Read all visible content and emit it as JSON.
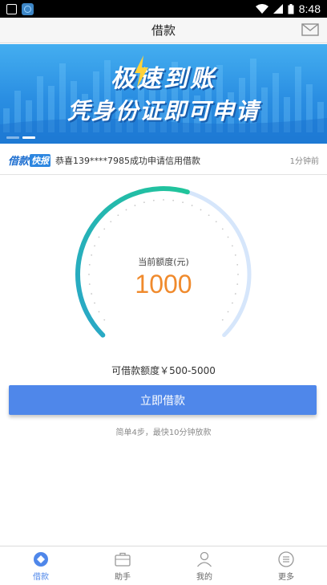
{
  "status_bar": {
    "time": "8:48"
  },
  "header": {
    "title": "借款"
  },
  "banner": {
    "line1": "极速到账",
    "line2": "凭身份证即可申请",
    "slide_count": 2,
    "active_slide": 1
  },
  "ticker": {
    "logo_part1": "借款",
    "logo_part2": "快报",
    "message": "恭喜139****7985成功申请信用借款",
    "time": "1分钟前"
  },
  "gauge": {
    "label": "当前额度(元)",
    "value": "1000",
    "amount": 1000,
    "min": 500,
    "max": 5000
  },
  "range_text": "可借款额度￥500-5000",
  "borrow_button": "立即借款",
  "hint": "简单4步，最快10分钟放款",
  "nav": {
    "items": [
      {
        "label": "借款",
        "icon": "loan-icon",
        "active": true
      },
      {
        "label": "助手",
        "icon": "briefcase-icon",
        "active": false
      },
      {
        "label": "我的",
        "icon": "person-icon",
        "active": false
      },
      {
        "label": "更多",
        "icon": "more-icon",
        "active": false
      }
    ]
  },
  "colors": {
    "accent": "#4f87ea",
    "amount": "#f08a2c",
    "gauge_start": "#2aa6c9",
    "gauge_end": "#20c59a",
    "gauge_track": "#d6e6fb"
  }
}
